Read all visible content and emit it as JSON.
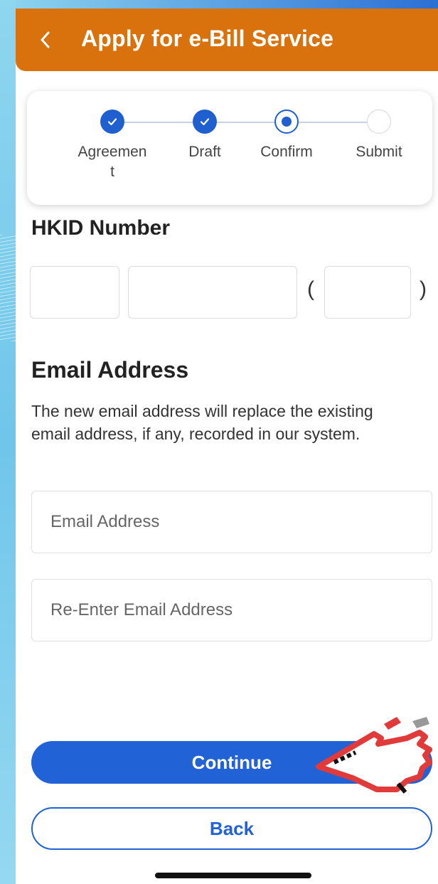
{
  "app": {
    "title": "Apply for e-Bill Service",
    "back_icon": "chevron-left-icon"
  },
  "stepper": {
    "steps": [
      {
        "label": "Agreement",
        "state": "done"
      },
      {
        "label": "Draft",
        "state": "done"
      },
      {
        "label": "Confirm",
        "state": "current"
      },
      {
        "label": "Submit",
        "state": "todo"
      }
    ],
    "active_color": "#1f5fd0"
  },
  "hkid": {
    "label": "HKID Number",
    "open_paren": "(",
    "close_paren": ")"
  },
  "email": {
    "heading": "Email Address",
    "description": "The new email address will replace the existing email address, if any, recorded in our system.",
    "email_placeholder": "Email Address",
    "reenter_placeholder": "Re-Enter Email Address"
  },
  "actions": {
    "continue_label": "Continue",
    "back_label": "Back"
  },
  "colors": {
    "header": "#d9720c",
    "primary": "#2162d6"
  }
}
